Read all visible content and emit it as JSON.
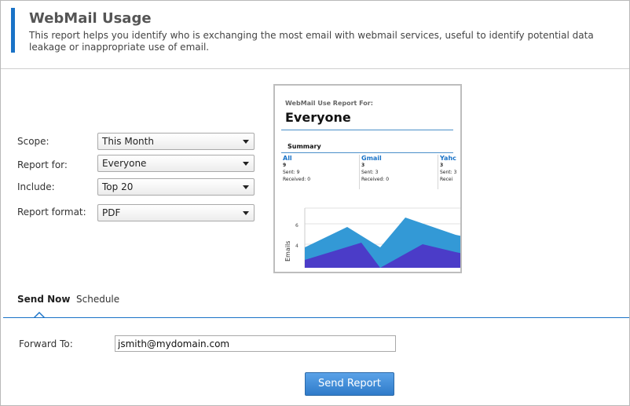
{
  "header": {
    "title": "WebMail Usage",
    "description": "This report helps you identify who is exchanging the most email with webmail services, useful to identify potential data leakage or inappropriate use of email."
  },
  "form": {
    "scope": {
      "label": "Scope:",
      "value": "This Month"
    },
    "report_for": {
      "label": "Report for:",
      "value": "Everyone"
    },
    "include": {
      "label": "Include:",
      "value": "Top 20"
    },
    "format": {
      "label": "Report format:",
      "value": "PDF"
    }
  },
  "preview": {
    "subtitle": "WebMail Use Report For:",
    "title": "Everyone",
    "summary_label": "Summary",
    "columns": [
      {
        "name": "All",
        "count": "9",
        "sent": "Sent: 9",
        "received": "Received: 0"
      },
      {
        "name": "Gmail",
        "count": "3",
        "sent": "Sent: 3",
        "received": "Received: 0"
      },
      {
        "name": "Yahc",
        "count": "3",
        "sent": "Sent: 3",
        "received": "Recei"
      }
    ],
    "chart": {
      "ylabel": "Emails",
      "ticks": [
        "6",
        "4"
      ],
      "colors": {
        "light": "#3399d6",
        "dark": "#4b3cc8"
      }
    }
  },
  "tabs": [
    {
      "label": "Send Now",
      "active": true
    },
    {
      "label": "Schedule",
      "active": false
    }
  ],
  "forward": {
    "label": "Forward To:",
    "value": "jsmith@mydomain.com"
  },
  "send_button": "Send Report"
}
